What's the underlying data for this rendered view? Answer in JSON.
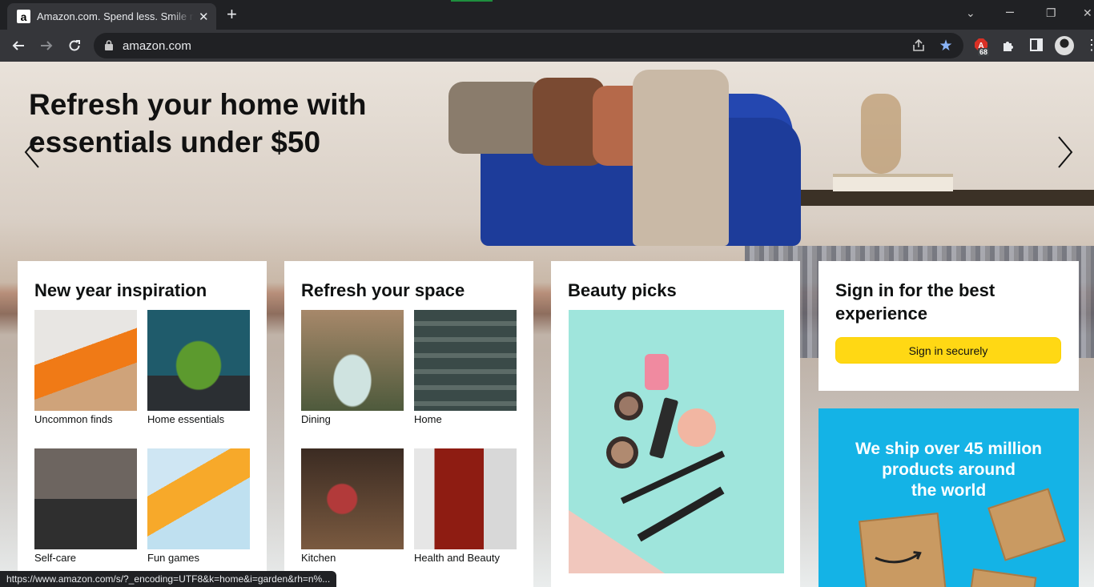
{
  "browser": {
    "tab_title": "Amazon.com. Spend less. Smile more.",
    "favicon_letter": "a",
    "url": "amazon.com",
    "extension_badge": "68",
    "status_url": "https://www.amazon.com/s/?_encoding=UTF8&k=home&i=garden&rh=n%..."
  },
  "hero": {
    "title_line1": "Refresh your home with",
    "title_line2": "essentials under $50"
  },
  "cards": {
    "new_year": {
      "title": "New year inspiration",
      "tiles": [
        {
          "label": "Uncommon finds"
        },
        {
          "label": "Home essentials"
        },
        {
          "label": "Self-care"
        },
        {
          "label": "Fun games"
        }
      ]
    },
    "refresh": {
      "title": "Refresh your space",
      "tiles": [
        {
          "label": "Dining"
        },
        {
          "label": "Home"
        },
        {
          "label": "Kitchen"
        },
        {
          "label": "Health and Beauty"
        }
      ]
    },
    "beauty": {
      "title": "Beauty picks"
    },
    "signin": {
      "title": "Sign in for the best experience",
      "button": "Sign in securely"
    },
    "ship": {
      "line1": "We ship over 45 million",
      "line2": "products around",
      "line3": "the world"
    }
  },
  "colors": {
    "signin_button": "#ffd814",
    "ship_bg": "#14b3e6",
    "star_blue": "#8ab4f8"
  }
}
